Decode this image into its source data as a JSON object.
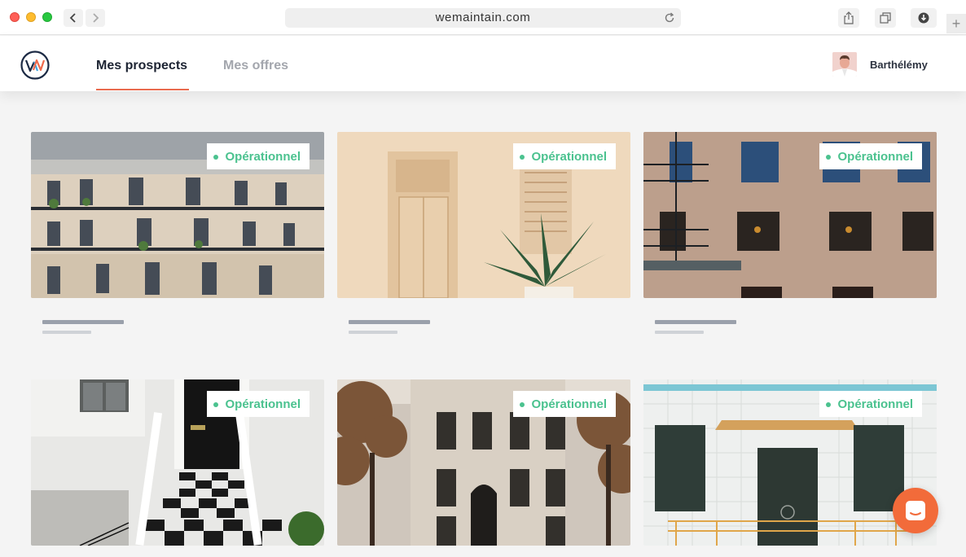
{
  "browser": {
    "url": "wemaintain.com"
  },
  "header": {
    "tabs": [
      {
        "label": "Mes prospects",
        "active": true
      },
      {
        "label": "Mes offres",
        "active": false
      }
    ],
    "user": {
      "name": "Barthélémy"
    }
  },
  "cards": [
    {
      "status": "Opérationnel",
      "image": "parisian-apartment-building"
    },
    {
      "status": "Opérationnel",
      "image": "beige-door-with-palm"
    },
    {
      "status": "Opérationnel",
      "image": "brick-building-fire-escape"
    },
    {
      "status": "Opérationnel",
      "image": "black-door-checkered-steps"
    },
    {
      "status": "Opérationnel",
      "image": "stone-townhouse-facade"
    },
    {
      "status": "Opérationnel",
      "image": "white-tile-facade-awning"
    }
  ],
  "colors": {
    "accent": "#e96a4e",
    "status_green": "#4bc28f",
    "chat": "#f26b3a"
  }
}
